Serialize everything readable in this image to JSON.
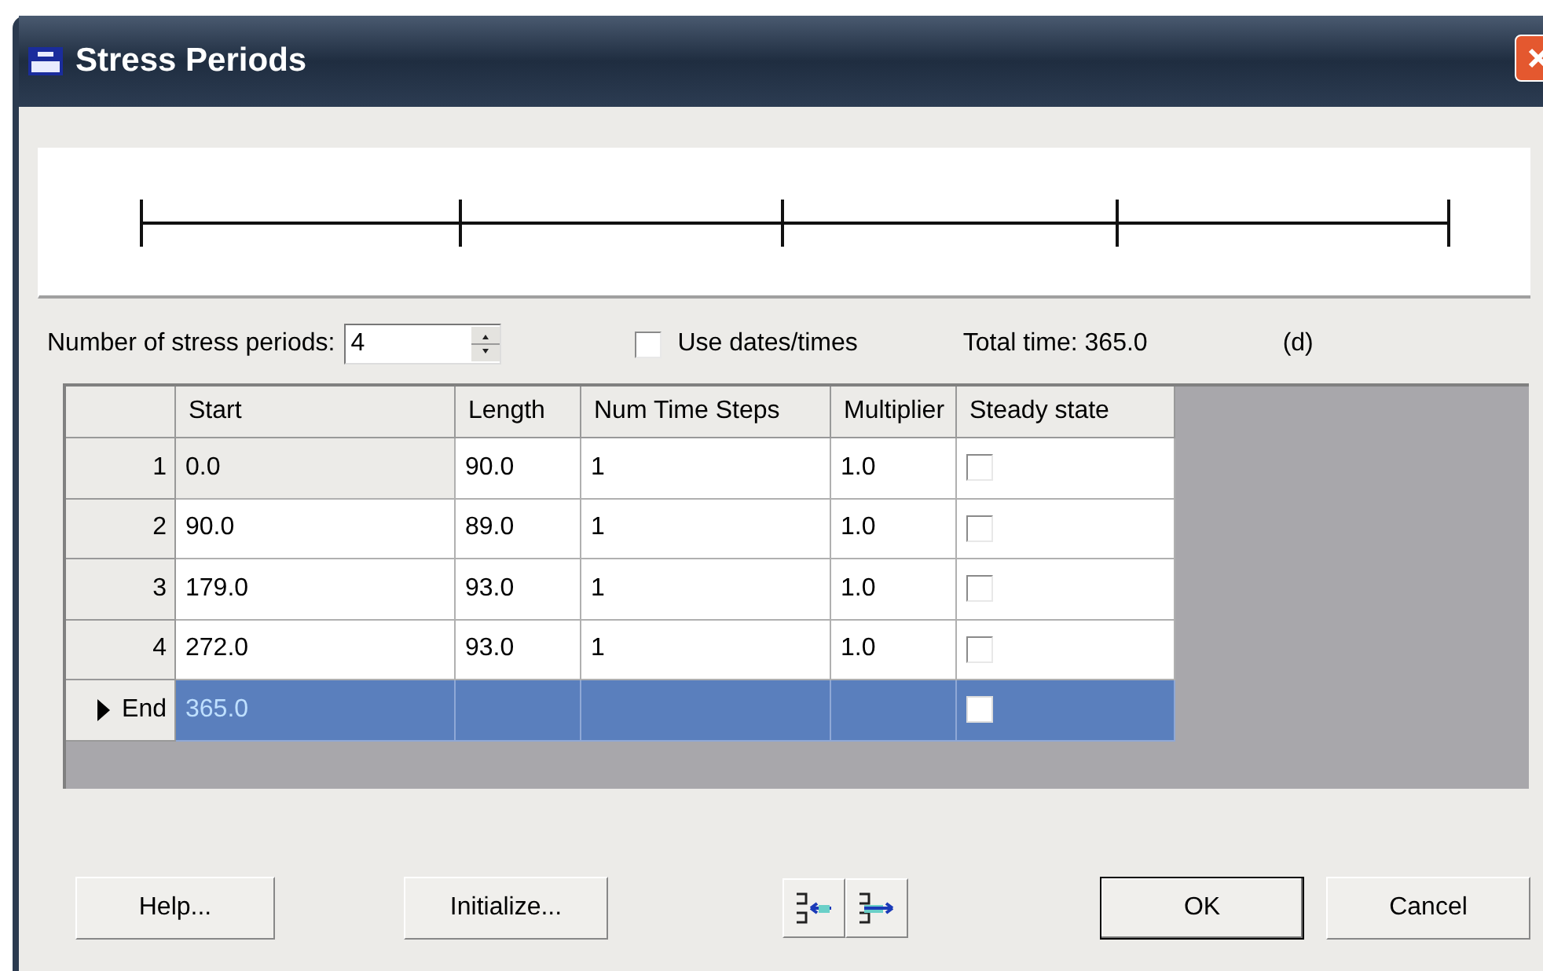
{
  "window": {
    "title": "Stress Periods"
  },
  "controls": {
    "count_label": "Number of stress periods:",
    "count_value": "4",
    "use_dates": {
      "label": "Use dates/times",
      "checked": false
    },
    "total_time": "Total time: 365.0",
    "unit": "(d)"
  },
  "table": {
    "columns": [
      "Start",
      "Length",
      "Num Time Steps",
      "Multiplier",
      "Steady state"
    ],
    "rows": [
      {
        "header": "1",
        "start": "0.0",
        "length": "90.0",
        "steps": "1",
        "multiplier": "1.0",
        "steady_state": false,
        "selected": false,
        "current": false
      },
      {
        "header": "2",
        "start": "90.0",
        "length": "89.0",
        "steps": "1",
        "multiplier": "1.0",
        "steady_state": false,
        "selected": false,
        "current": false
      },
      {
        "header": "3",
        "start": "179.0",
        "length": "93.0",
        "steps": "1",
        "multiplier": "1.0",
        "steady_state": false,
        "selected": false,
        "current": false
      },
      {
        "header": "4",
        "start": "272.0",
        "length": "93.0",
        "steps": "1",
        "multiplier": "1.0",
        "steady_state": false,
        "selected": false,
        "current": false
      },
      {
        "header": "End",
        "start": "365.0",
        "length": "",
        "steps": "",
        "multiplier": "",
        "steady_state": false,
        "selected": true,
        "current": true
      }
    ]
  },
  "buttons": {
    "help": "Help...",
    "initialize": "Initialize...",
    "ok": "OK",
    "cancel": "Cancel"
  }
}
